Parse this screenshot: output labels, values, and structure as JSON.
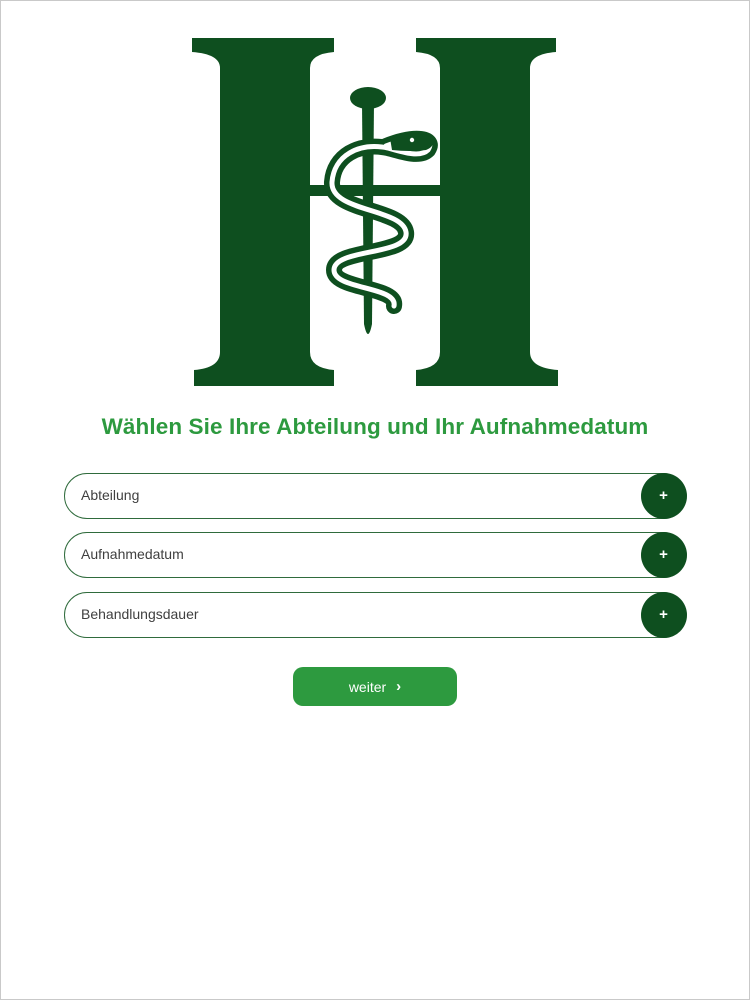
{
  "colors": {
    "primary_dark": "#0e4f1f",
    "primary_green": "#2d9a3f",
    "logo_green": "#0e4f1f",
    "field_border": "#2f6b3c",
    "text_dark": "#3f3f3f"
  },
  "logo": {
    "icon": "rod-of-asclepius-h-logo"
  },
  "headline": "Wählen Sie Ihre Abteilung und Ihr Aufnahmedatum",
  "fields": [
    {
      "label": "Abteilung",
      "action_icon": "plus-icon",
      "action_glyph": "+"
    },
    {
      "label": "Aufnahmedatum",
      "action_icon": "plus-icon",
      "action_glyph": "+"
    },
    {
      "label": "Behandlungsdauer",
      "action_icon": "plus-icon",
      "action_glyph": "+"
    }
  ],
  "next_button": {
    "label": "weiter",
    "icon": "chevron-right-icon",
    "glyph": "›"
  }
}
